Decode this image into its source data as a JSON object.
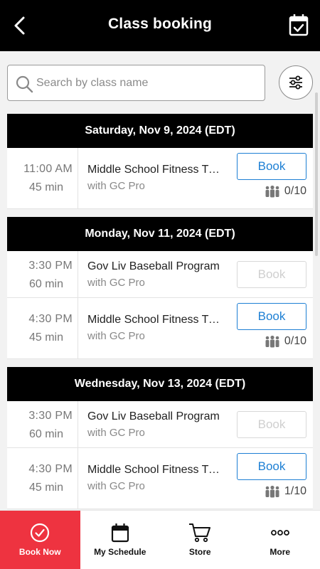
{
  "header": {
    "title": "Class booking",
    "back_icon": "chevron-left-icon",
    "calendar_icon": "calendar-check-icon"
  },
  "search": {
    "placeholder": "Search by class name",
    "value": ""
  },
  "days": [
    {
      "label": "Saturday, Nov 9, 2024 (EDT)",
      "classes": [
        {
          "time": "11:00  AM",
          "duration": "45 min",
          "name": "Middle School Fitness Training",
          "instructor": "with GC Pro",
          "button": "Book",
          "enabled": true,
          "capacity": "0/10"
        }
      ]
    },
    {
      "label": "Monday, Nov 11, 2024 (EDT)",
      "classes": [
        {
          "time": "3:30  PM",
          "duration": "60 min",
          "name": "Gov Liv Baseball Program",
          "instructor": "with GC Pro",
          "button": "Book",
          "enabled": false,
          "capacity": ""
        },
        {
          "time": "4:30  PM",
          "duration": "45 min",
          "name": "Middle School Fitness Training",
          "instructor": "with GC Pro",
          "button": "Book",
          "enabled": true,
          "capacity": "0/10"
        }
      ]
    },
    {
      "label": "Wednesday, Nov 13, 2024 (EDT)",
      "classes": [
        {
          "time": "3:30  PM",
          "duration": "60 min",
          "name": "Gov Liv Baseball Program",
          "instructor": "with GC Pro",
          "button": "Book",
          "enabled": false,
          "capacity": ""
        },
        {
          "time": "4:30  PM",
          "duration": "45 min",
          "name": "Middle School Fitness Training",
          "instructor": "with GC Pro",
          "button": "Book",
          "enabled": true,
          "capacity": "1/10"
        }
      ]
    }
  ],
  "nav": {
    "book_now": "Book Now",
    "my_schedule": "My Schedule",
    "store": "Store",
    "more": "More"
  },
  "colors": {
    "accent": "#ee3340",
    "link_blue": "#1d7fd4",
    "header_bg": "#000000"
  }
}
